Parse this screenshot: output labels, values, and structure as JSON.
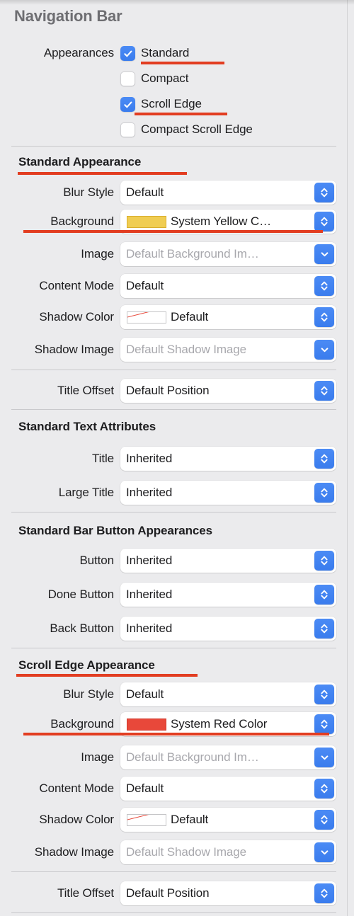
{
  "panel": {
    "title": "Navigation Bar"
  },
  "appearances": {
    "label": "Appearances",
    "options": [
      {
        "label": "Standard",
        "checked": true
      },
      {
        "label": "Compact",
        "checked": false
      },
      {
        "label": "Scroll Edge",
        "checked": true
      },
      {
        "label": "Compact Scroll Edge",
        "checked": false
      }
    ]
  },
  "sections": [
    {
      "header": "Standard Appearance",
      "rows": [
        {
          "label": "Blur Style",
          "value": "Default",
          "control": "popup",
          "swatch": "none-swatch",
          "placeholder": false
        },
        {
          "label": "Background",
          "value": "System Yellow C…",
          "control": "popup",
          "swatch": "yellow",
          "placeholder": false
        },
        {
          "label": "Image",
          "value": "Default Background Im…",
          "control": "pulldown",
          "placeholder": true
        },
        {
          "label": "Content Mode",
          "value": "Default",
          "control": "popup",
          "placeholder": false
        },
        {
          "label": "Shadow Color",
          "value": "Default",
          "control": "popup",
          "swatch": "nocolor",
          "placeholder": false
        },
        {
          "label": "Shadow Image",
          "value": "Default Shadow Image",
          "control": "pulldown",
          "placeholder": true
        }
      ]
    },
    {
      "header": "",
      "rows": [
        {
          "label": "Title Offset",
          "value": "Default Position",
          "control": "popup",
          "placeholder": false
        }
      ]
    },
    {
      "header": "Standard Text Attributes",
      "rows": [
        {
          "label": "Title",
          "value": "Inherited",
          "control": "popup",
          "placeholder": false
        },
        {
          "label": "Large Title",
          "value": "Inherited",
          "control": "popup",
          "placeholder": false
        }
      ]
    },
    {
      "header": "Standard Bar Button Appearances",
      "rows": [
        {
          "label": "Button",
          "value": "Inherited",
          "control": "popup",
          "placeholder": false
        },
        {
          "label": "Done Button",
          "value": "Inherited",
          "control": "popup",
          "placeholder": false
        },
        {
          "label": "Back Button",
          "value": "Inherited",
          "control": "popup",
          "placeholder": false
        }
      ]
    },
    {
      "header": "Scroll Edge Appearance",
      "rows": [
        {
          "label": "Blur Style",
          "value": "Default",
          "control": "popup",
          "placeholder": false
        },
        {
          "label": "Background",
          "value": "System Red Color",
          "control": "popup",
          "swatch": "red",
          "placeholder": false
        },
        {
          "label": "Image",
          "value": "Default Background Im…",
          "control": "pulldown",
          "placeholder": true
        },
        {
          "label": "Content Mode",
          "value": "Default",
          "control": "popup",
          "placeholder": false
        },
        {
          "label": "Shadow Color",
          "value": "Default",
          "control": "popup",
          "swatch": "nocolor",
          "placeholder": false
        },
        {
          "label": "Shadow Image",
          "value": "Default Shadow Image",
          "control": "pulldown",
          "placeholder": true
        }
      ]
    },
    {
      "header": "",
      "rows": [
        {
          "label": "Title Offset",
          "value": "Default Position",
          "control": "popup",
          "placeholder": false
        }
      ]
    }
  ],
  "rows_flat": [
    {
      "label": "Blur Style",
      "value": "Default"
    },
    {
      "label": "Background",
      "value": "System Yellow C…"
    },
    {
      "label": "Image",
      "value": "Default Background Im…"
    },
    {
      "label": "Content Mode",
      "value": "Default"
    },
    {
      "label": "Shadow Color",
      "value": "Default"
    },
    {
      "label": "Shadow Image",
      "value": "Default Shadow Image"
    },
    {
      "label": "Title Offset",
      "value": "Default Position"
    },
    {
      "label": "Title",
      "value": "Inherited"
    },
    {
      "label": "Large Title",
      "value": "Inherited"
    },
    {
      "label": "Button",
      "value": "Inherited"
    },
    {
      "label": "Done Button",
      "value": "Inherited"
    },
    {
      "label": "Back Button",
      "value": "Inherited"
    },
    {
      "label": "Blur Style",
      "value": "Default"
    },
    {
      "label": "Background",
      "value": "System Red Color"
    },
    {
      "label": "Image",
      "value": "Default Background Im…"
    },
    {
      "label": "Content Mode",
      "value": "Default"
    },
    {
      "label": "Shadow Color",
      "value": "Default"
    },
    {
      "label": "Shadow Image",
      "value": "Default Shadow Image"
    },
    {
      "label": "Title Offset",
      "value": "Default Position"
    }
  ],
  "headers": {
    "standard_appearance": "Standard Appearance",
    "standard_text_attributes": "Standard Text Attributes",
    "standard_bar_button_appearances": "Standard Bar Button Appearances",
    "scroll_edge_appearance": "Scroll Edge Appearance"
  },
  "colors": {
    "panel_background": "#ebebed",
    "accent_blue": "#3a7ced",
    "annotation_red": "#e23d21",
    "swatch_yellow": "#f0cd52",
    "swatch_red": "#e8483a",
    "label_text": "#1d1d1f",
    "placeholder_text": "#a8a8ad",
    "title_text": "#6e6e72"
  },
  "icons": {
    "popup": "chevron-up-down-icon",
    "pulldown": "chevron-down-icon",
    "checkmark": "checkmark-icon",
    "no_color": "no-color-swatch-icon"
  }
}
